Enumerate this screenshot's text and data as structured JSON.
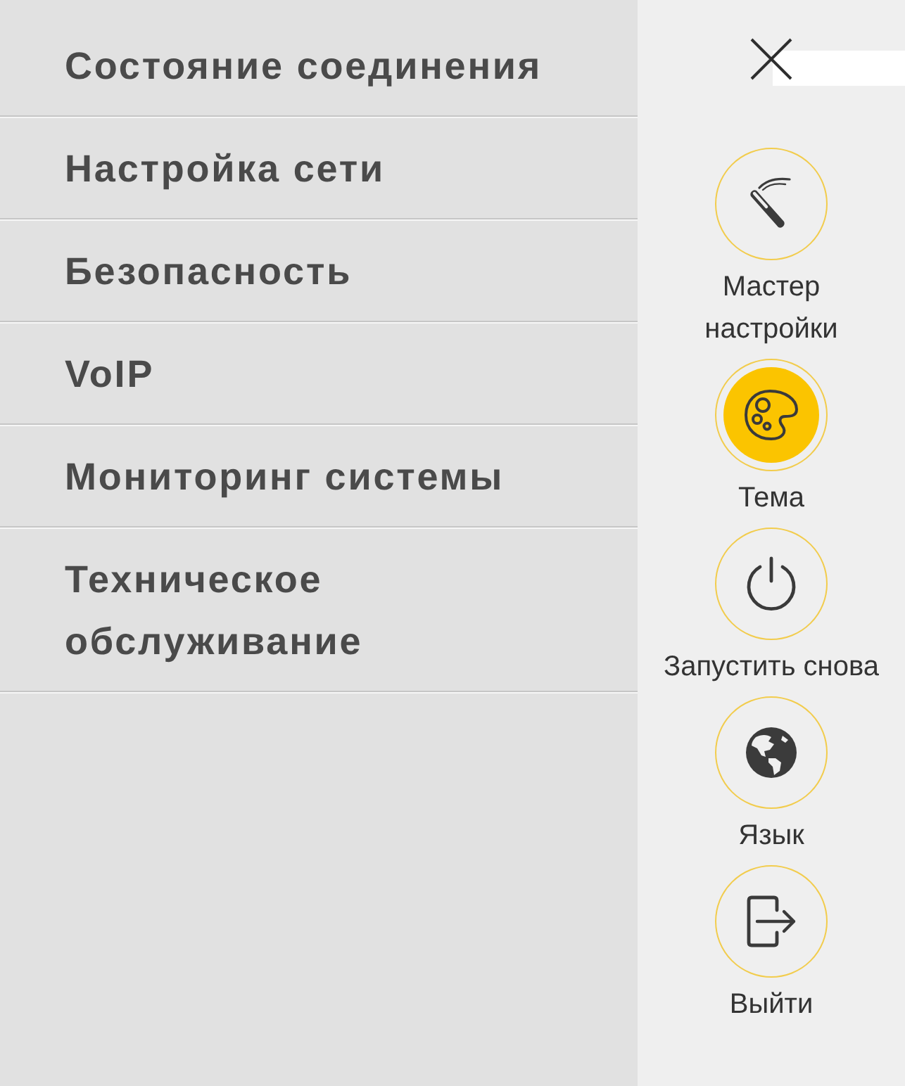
{
  "menu": {
    "items": [
      {
        "label": "Состояние соединения"
      },
      {
        "label": "Настройка сети"
      },
      {
        "label": "Безопасность"
      },
      {
        "label": "VoIP"
      },
      {
        "label": "Мониторинг системы"
      },
      {
        "label": "Техническое обслуживание"
      }
    ]
  },
  "actions": [
    {
      "kind": "wizard",
      "label": "Мастер настройки",
      "selected": false
    },
    {
      "kind": "theme",
      "label": "Тема",
      "selected": true
    },
    {
      "kind": "restart",
      "label": "Запустить снова",
      "selected": false
    },
    {
      "kind": "language",
      "label": "Язык",
      "selected": false
    },
    {
      "kind": "logout",
      "label": "Выйти",
      "selected": false
    }
  ]
}
